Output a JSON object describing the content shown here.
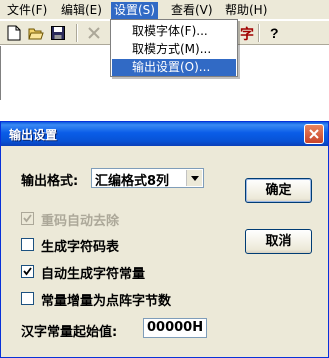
{
  "menubar": {
    "items": [
      {
        "label": "文件(F)"
      },
      {
        "label": "编辑(E)"
      },
      {
        "label": "设置(S)"
      },
      {
        "label": "查看(V)"
      },
      {
        "label": "帮助(H)"
      }
    ]
  },
  "toolbar": {
    "icons": [
      "new-file-icon",
      "open-folder-icon",
      "save-icon",
      "close-x-icon",
      "help-icon"
    ],
    "glyph_text": "字"
  },
  "settings_menu": {
    "items": [
      {
        "label": "取模字体(F)..."
      },
      {
        "label": "取模方式(M)..."
      },
      {
        "label": "输出设置(O)..."
      }
    ]
  },
  "dialog": {
    "title": "输出设置",
    "format_label": "输出格式:",
    "format_value": "汇编格式8列",
    "ok_label": "确定",
    "cancel_label": "取消",
    "options": [
      {
        "label": "重码自动去除",
        "checked": true,
        "disabled": true
      },
      {
        "label": "生成字符码表",
        "checked": false,
        "disabled": false
      },
      {
        "label": "自动生成字符常量",
        "checked": true,
        "disabled": false
      },
      {
        "label": "常量增量为点阵字节数",
        "checked": false,
        "disabled": false
      }
    ],
    "start_label": "汉字常量起始值:",
    "start_value": "00000H"
  },
  "colors": {
    "highlight": "#316ac5",
    "titlebar": "#0a5de8",
    "dialog_bg": "#ece9d8"
  }
}
